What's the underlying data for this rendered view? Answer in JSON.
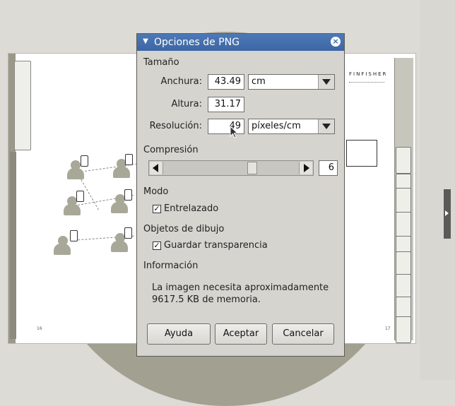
{
  "background": {
    "left_page_number": "16",
    "right_page_number": "17",
    "logo_text": "FINFISHER"
  },
  "dialog": {
    "title": "Opciones de PNG",
    "size_section": "Tamaño",
    "width_label": "Anchura:",
    "width_value": "43.49",
    "width_unit": "cm",
    "height_label": "Altura:",
    "height_value": "31.17",
    "resolution_label": "Resolución:",
    "resolution_value": "49",
    "resolution_unit": "píxeles/cm",
    "compression_section": "Compresión",
    "compression_value": "6",
    "compression_level": 0.667,
    "mode_section": "Modo",
    "interlaced_label": "Entrelazado",
    "interlaced_checked": true,
    "drawing_section": "Objetos de dibujo",
    "transparency_label": "Guardar transparencia",
    "transparency_checked": true,
    "info_section": "Información",
    "info_line1": "La imagen necesita aproximadamente",
    "info_line2": "9617.5 KB de memoria.",
    "help_button": "Ayuda",
    "accept_button": "Aceptar",
    "cancel_button": "Cancelar"
  },
  "colors": {
    "titlebar": "#4e79b7",
    "dialog_bg": "#d6d4cf"
  }
}
